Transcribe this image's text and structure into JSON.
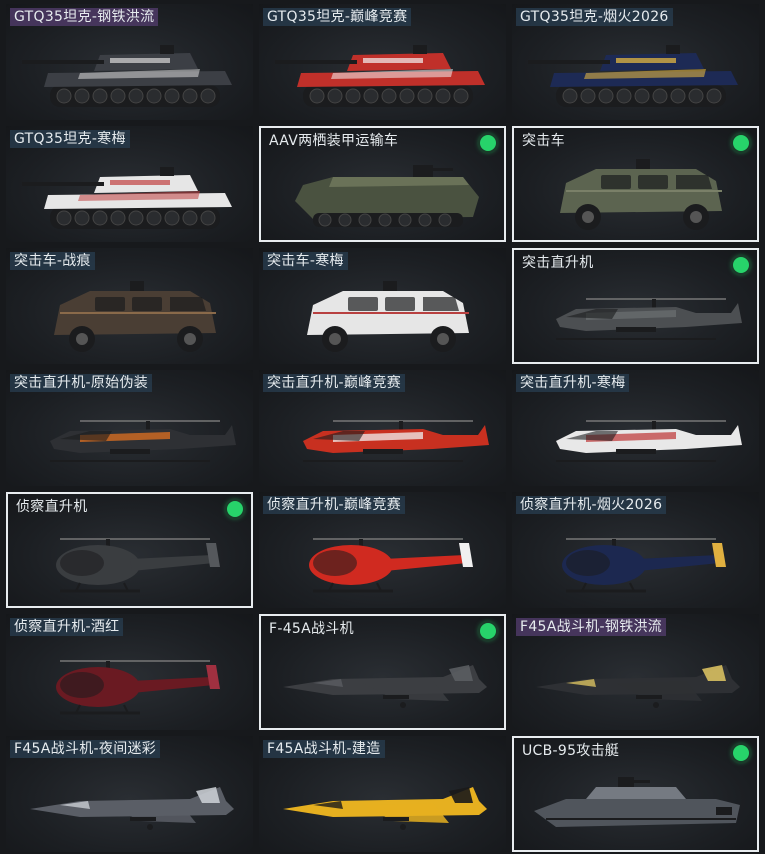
{
  "cards": [
    {
      "label": "GTQ35坦克-钢铁洪流",
      "type": "tank",
      "color": "#3c3f45",
      "accent": "#d8d8d8",
      "label_style": "purple",
      "selected": false,
      "owned": false
    },
    {
      "label": "GTQ35坦克-巅峰竞赛",
      "type": "tank",
      "color": "#c0302a",
      "accent": "#f2f2f2",
      "label_style": "blue",
      "selected": false,
      "owned": false
    },
    {
      "label": "GTQ35坦克-烟火2026",
      "type": "tank",
      "color": "#1d2a55",
      "accent": "#f0c040",
      "label_style": "blue",
      "selected": false,
      "owned": false
    },
    {
      "label": "GTQ35坦克-寒梅",
      "type": "tank",
      "color": "#e6e6e6",
      "accent": "#c04040",
      "label_style": "blue",
      "selected": false,
      "owned": false
    },
    {
      "label": "AAV两栖装甲运输车",
      "type": "apc",
      "color": "#4a5240",
      "accent": "#6a7258",
      "label_style": "plain",
      "selected": true,
      "owned": true
    },
    {
      "label": "突击车",
      "type": "truck",
      "color": "#5c6450",
      "accent": "#7a8068",
      "label_style": "plain",
      "selected": true,
      "owned": true
    },
    {
      "label": "突击车-战痕",
      "type": "truck",
      "color": "#4a3e34",
      "accent": "#8a6a4a",
      "label_style": "blue",
      "selected": false,
      "owned": false
    },
    {
      "label": "突击车-寒梅",
      "type": "truck",
      "color": "#e6e6e6",
      "accent": "#b84040",
      "label_style": "blue",
      "selected": false,
      "owned": false
    },
    {
      "label": "突击直升机",
      "type": "gunship",
      "color": "#4c4f52",
      "accent": "#6a6d70",
      "label_style": "plain",
      "selected": true,
      "owned": true
    },
    {
      "label": "突击直升机-原始伪装",
      "type": "gunship",
      "color": "#2e3034",
      "accent": "#e07020",
      "label_style": "blue",
      "selected": false,
      "owned": false
    },
    {
      "label": "突击直升机-巅峰竞赛",
      "type": "gunship",
      "color": "#c83020",
      "accent": "#f0f0f0",
      "label_style": "blue",
      "selected": false,
      "owned": false
    },
    {
      "label": "突击直升机-寒梅",
      "type": "gunship",
      "color": "#e8e8e8",
      "accent": "#c04040",
      "label_style": "blue",
      "selected": false,
      "owned": false
    },
    {
      "label": "侦察直升机",
      "type": "scout",
      "color": "#3a3d40",
      "accent": "#55585c",
      "label_style": "plain",
      "selected": true,
      "owned": true
    },
    {
      "label": "侦察直升机-巅峰竞赛",
      "type": "scout",
      "color": "#d02a20",
      "accent": "#f0f0f0",
      "label_style": "blue",
      "selected": false,
      "owned": false
    },
    {
      "label": "侦察直升机-烟火2026",
      "type": "scout",
      "color": "#1c2850",
      "accent": "#e0b040",
      "label_style": "blue",
      "selected": false,
      "owned": false
    },
    {
      "label": "侦察直升机-酒红",
      "type": "scout",
      "color": "#6a1a22",
      "accent": "#a03040",
      "label_style": "blue",
      "selected": false,
      "owned": false
    },
    {
      "label": "F-45A战斗机",
      "type": "jet",
      "color": "#3c3e42",
      "accent": "#5a5d62",
      "label_style": "plain",
      "selected": true,
      "owned": true
    },
    {
      "label": "F45A战斗机-钢铁洪流",
      "type": "jet",
      "color": "#2e3034",
      "accent": "#d8c060",
      "label_style": "purple",
      "selected": false,
      "owned": false
    },
    {
      "label": "F45A战斗机-夜间迷彩",
      "type": "jet",
      "color": "#5a5e66",
      "accent": "#c8ccd2",
      "label_style": "blue",
      "selected": false,
      "owned": false
    },
    {
      "label": "F45A战斗机-建造",
      "type": "jet",
      "color": "#e6b020",
      "accent": "#1a1a1a",
      "label_style": "blue",
      "selected": false,
      "owned": false
    },
    {
      "label": "UCB-95攻击艇",
      "type": "boat",
      "color": "#50555c",
      "accent": "#757a82",
      "label_style": "plain",
      "selected": true,
      "owned": true
    }
  ]
}
